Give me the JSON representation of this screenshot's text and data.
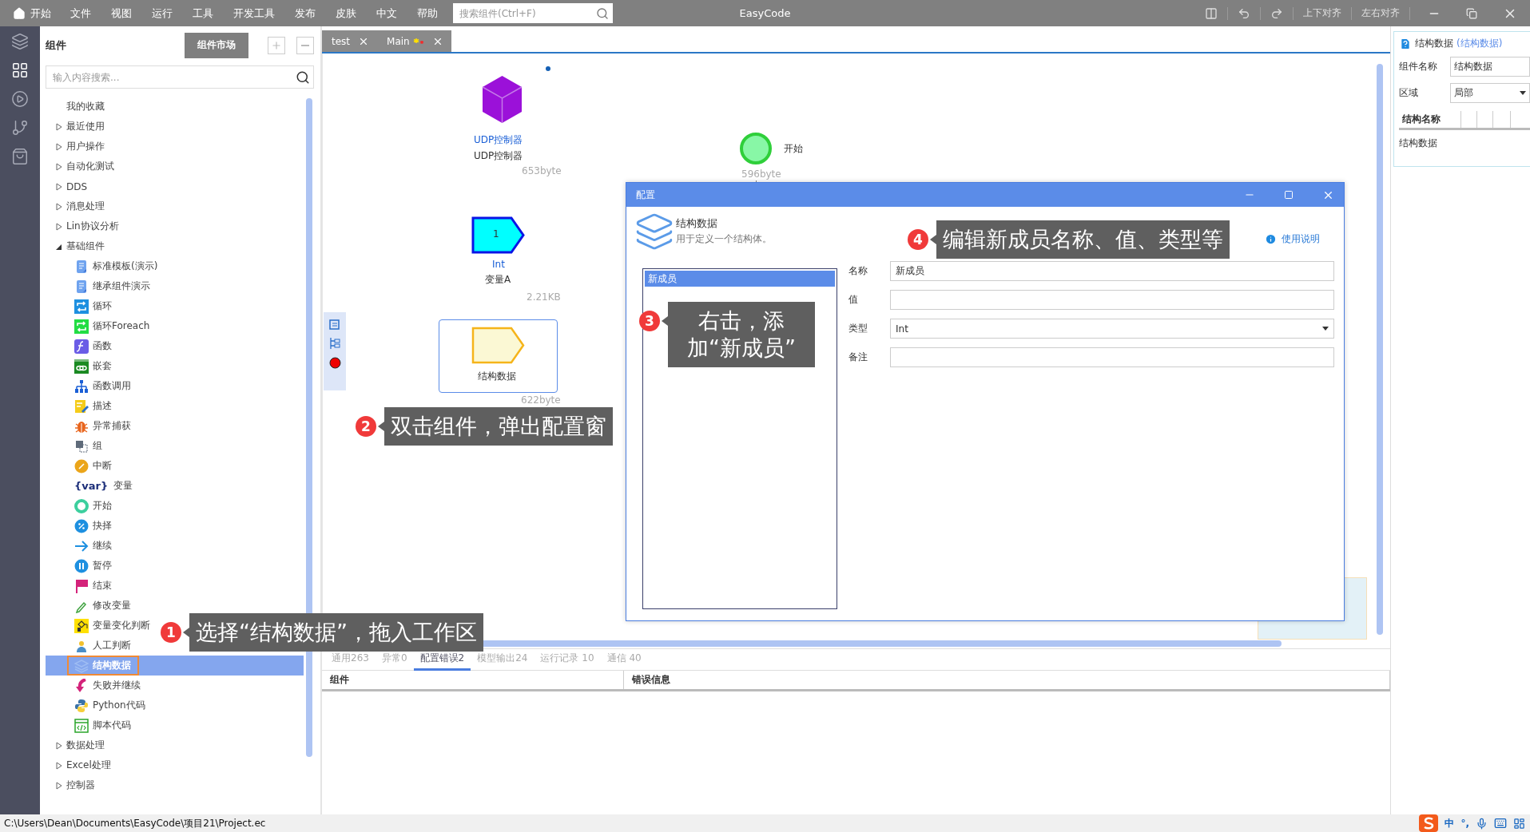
{
  "window": {
    "title": "EasyCode"
  },
  "menu_bar": {
    "home_item": "开始",
    "items": [
      "文件",
      "视图",
      "运行",
      "工具",
      "开发工具",
      "发布",
      "皮肤",
      "中文",
      "帮助"
    ]
  },
  "search": {
    "placeholder": "搜索组件(Ctrl+F)"
  },
  "toolbar": {
    "buttons": [
      "上下对齐",
      "左右对齐"
    ]
  },
  "rail": [
    {
      "kind": "layers",
      "selected": false
    },
    {
      "kind": "grid",
      "selected": true
    },
    {
      "kind": "play",
      "selected": false
    },
    {
      "kind": "branch",
      "selected": false
    },
    {
      "kind": "bag",
      "selected": false
    }
  ],
  "component_panel": {
    "title": "组件",
    "market_button": "组件市场",
    "search_placeholder": "输入内容搜索...",
    "tree": [
      {
        "label": "我的收藏"
      },
      {
        "label": "最近使用",
        "expanded": false
      },
      {
        "label": "用户操作",
        "expanded": false
      },
      {
        "label": "自动化测试",
        "expanded": false
      },
      {
        "label": "DDS",
        "expanded": false
      },
      {
        "label": "消息处理",
        "expanded": false
      },
      {
        "label": "Lin协议分析",
        "expanded": false
      },
      {
        "label": "基础组件",
        "expanded": true,
        "children": [
          {
            "label": "标准模板(演示)",
            "kind": "doc",
            "selected": false
          },
          {
            "label": "继承组件演示",
            "kind": "doc",
            "selected": false
          },
          {
            "label": "循环",
            "kind": "loop",
            "selected": false
          },
          {
            "label": "循环Foreach",
            "kind": "foreach",
            "selected": false
          },
          {
            "label": "函数",
            "kind": "function",
            "selected": false
          },
          {
            "label": "嵌套",
            "kind": "nest",
            "selected": false
          },
          {
            "label": "函数调用",
            "kind": "call",
            "selected": false
          },
          {
            "label": "描述",
            "kind": "note",
            "selected": false
          },
          {
            "label": "异常捕获",
            "kind": "catch",
            "selected": false
          },
          {
            "label": "组",
            "kind": "group",
            "selected": false
          },
          {
            "label": "中断",
            "kind": "break",
            "selected": false
          },
          {
            "label": "变量",
            "kind": "var",
            "icon_text": "{var}",
            "selected": false
          },
          {
            "label": "开始",
            "kind": "start",
            "selected": false
          },
          {
            "label": "抉择",
            "kind": "choose",
            "selected": false
          },
          {
            "label": "继续",
            "kind": "continue",
            "selected": false
          },
          {
            "label": "暂停",
            "kind": "pause",
            "selected": false
          },
          {
            "label": "结束",
            "kind": "end",
            "selected": false
          },
          {
            "label": "修改变量",
            "kind": "edit",
            "selected": false
          },
          {
            "label": "变量变化判断",
            "kind": "watch",
            "selected": false
          },
          {
            "label": "人工判断",
            "kind": "manual",
            "selected": false
          },
          {
            "label": "结构数据",
            "kind": "struct",
            "selected": true
          },
          {
            "label": "失败并继续",
            "kind": "retry",
            "selected": false
          },
          {
            "label": "Python代码",
            "kind": "python",
            "selected": false
          },
          {
            "label": "脚本代码",
            "kind": "script",
            "selected": false
          }
        ]
      },
      {
        "label": "数据处理",
        "expanded": false
      },
      {
        "label": "Excel处理",
        "expanded": false
      },
      {
        "label": "控制器",
        "expanded": false
      }
    ]
  },
  "editor_tabs": [
    {
      "label": "test",
      "modified": false
    },
    {
      "label": "Main",
      "modified": true
    }
  ],
  "canvas": {
    "nodes": [
      {
        "kind": "cube",
        "title": "UDP控制器",
        "name": "UDP控制器",
        "size": "653byte",
        "selected": false
      },
      {
        "kind": "start",
        "name": "开始",
        "size": "596byte",
        "selected": false
      },
      {
        "kind": "variable",
        "value": "1",
        "title": "Int",
        "name": "变量A",
        "size": "2.21KB",
        "selected": false
      },
      {
        "kind": "struct",
        "name": "结构数据",
        "size": "622byte",
        "selected": true
      }
    ]
  },
  "dialog": {
    "title": "配置",
    "heading": "结构数据",
    "description": "用于定义一个结构体。",
    "help_link": "使用说明",
    "members": [
      {
        "label": "新成员",
        "selected": true
      }
    ],
    "fields": [
      {
        "label": "名称",
        "kind": "text",
        "value": "新成员"
      },
      {
        "label": "值",
        "kind": "text"
      },
      {
        "label": "类型",
        "kind": "select",
        "value": "Int"
      },
      {
        "label": "备注",
        "kind": "text"
      }
    ]
  },
  "properties": {
    "title": "结构数据",
    "subtitle": "(结构数据)",
    "fields": [
      {
        "label": "组件名称",
        "kind": "text",
        "value": "结构数据"
      },
      {
        "label": "区域",
        "kind": "select",
        "value": "局部"
      }
    ],
    "table": {
      "columns": [
        "结构名称"
      ],
      "rows": [
        "结构数据"
      ]
    }
  },
  "output_panel": {
    "tabs": [
      {
        "label": "通用263",
        "selected": false
      },
      {
        "label": "异常0",
        "selected": false
      },
      {
        "label": "配置错误2",
        "selected": true
      },
      {
        "label": "模型输出24",
        "selected": false
      },
      {
        "label": "运行记录 10",
        "selected": false
      },
      {
        "label": "通信 40",
        "selected": false
      }
    ],
    "columns": [
      "组件",
      "错误信息"
    ]
  },
  "status_bar": {
    "path": "C:\\Users\\Dean\\Documents\\EasyCode\\项目21\\Project.ec",
    "ime": [
      "中",
      "°,"
    ]
  },
  "callouts": [
    {
      "number": "1",
      "text": "选择“结构数据”，拖入工作区"
    },
    {
      "number": "2",
      "text": "双击组件，弹出配置窗"
    },
    {
      "number": "3",
      "text": "右击，添加“新成员”"
    },
    {
      "number": "4",
      "text": "编辑新成员名称、值、类型等"
    }
  ]
}
